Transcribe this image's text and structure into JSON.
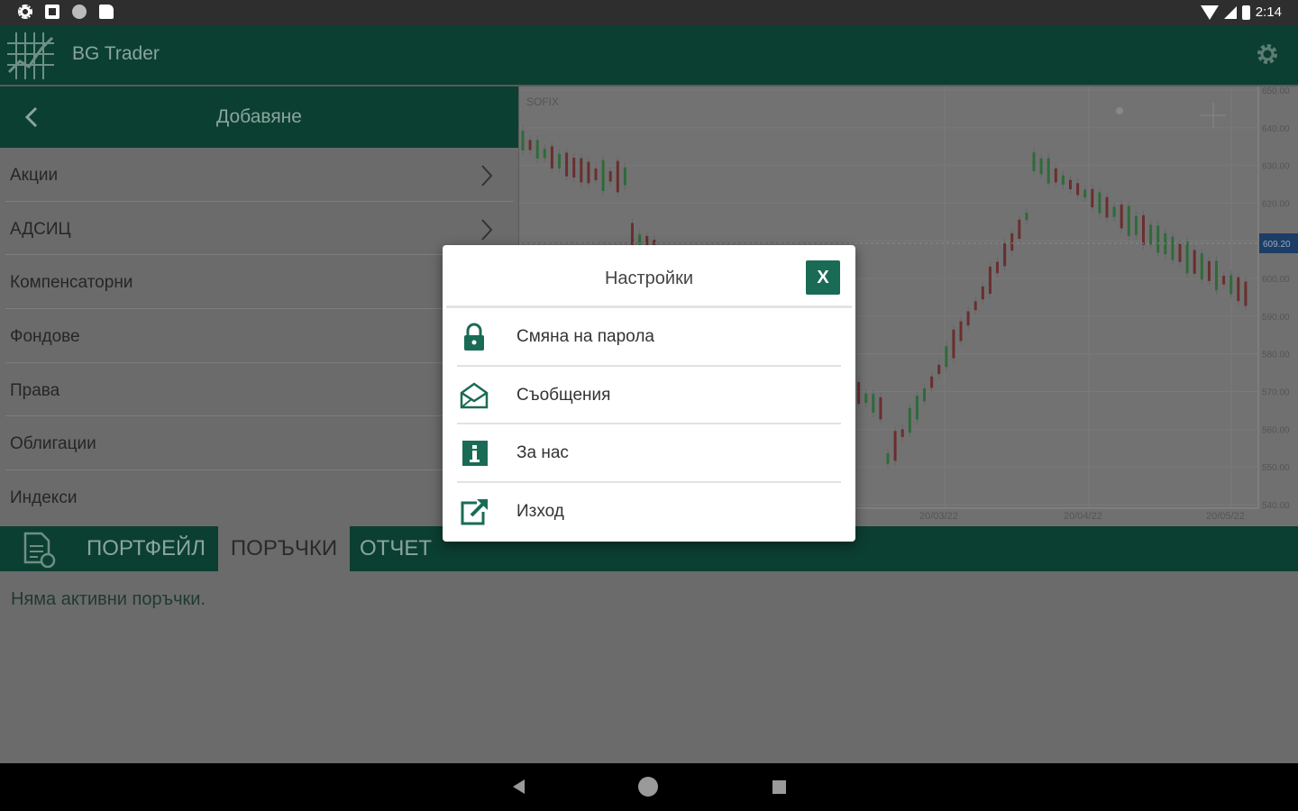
{
  "status_bar": {
    "time": "2:14"
  },
  "app": {
    "title": "BG Trader"
  },
  "left_panel": {
    "header_title": "Добавяне",
    "items": [
      {
        "label": "Акции",
        "has_chevron": true
      },
      {
        "label": "АДСИЦ",
        "has_chevron": true
      },
      {
        "label": "Компенсаторни",
        "has_chevron": false
      },
      {
        "label": "Фондове",
        "has_chevron": false
      },
      {
        "label": "Права",
        "has_chevron": false
      },
      {
        "label": "Облигации",
        "has_chevron": false
      },
      {
        "label": "Индекси",
        "has_chevron": false
      }
    ]
  },
  "chart": {
    "symbol": "SOFIX",
    "y_ticks": [
      "650.00",
      "640.00",
      "630.00",
      "620.00",
      "610.00",
      "600.00",
      "590.00",
      "580.00",
      "570.00",
      "560.00",
      "550.00",
      "540.00"
    ],
    "current_price": "609.20",
    "x_ticks": [
      "20/03/22",
      "20/04/22",
      "20/05/22"
    ]
  },
  "tabs": [
    {
      "label": "ПОРТФЕЙЛ",
      "active": false
    },
    {
      "label": "ПОРЪЧКИ",
      "active": true
    },
    {
      "label": "ОТЧЕТ",
      "active": false
    }
  ],
  "content": {
    "empty_message": "Няма активни поръчки."
  },
  "dialog": {
    "title": "Настройки",
    "close_label": "X",
    "items": [
      {
        "label": "Смяна на парола",
        "icon": "lock-icon"
      },
      {
        "label": "Съобщения",
        "icon": "envelope-icon"
      },
      {
        "label": "За нас",
        "icon": "info-icon"
      },
      {
        "label": "Изход",
        "icon": "exit-icon"
      }
    ]
  },
  "colors": {
    "primary_dark": "#0b3f31",
    "accent": "#1a6b55",
    "dim_overlay": "#6b6b6b"
  }
}
